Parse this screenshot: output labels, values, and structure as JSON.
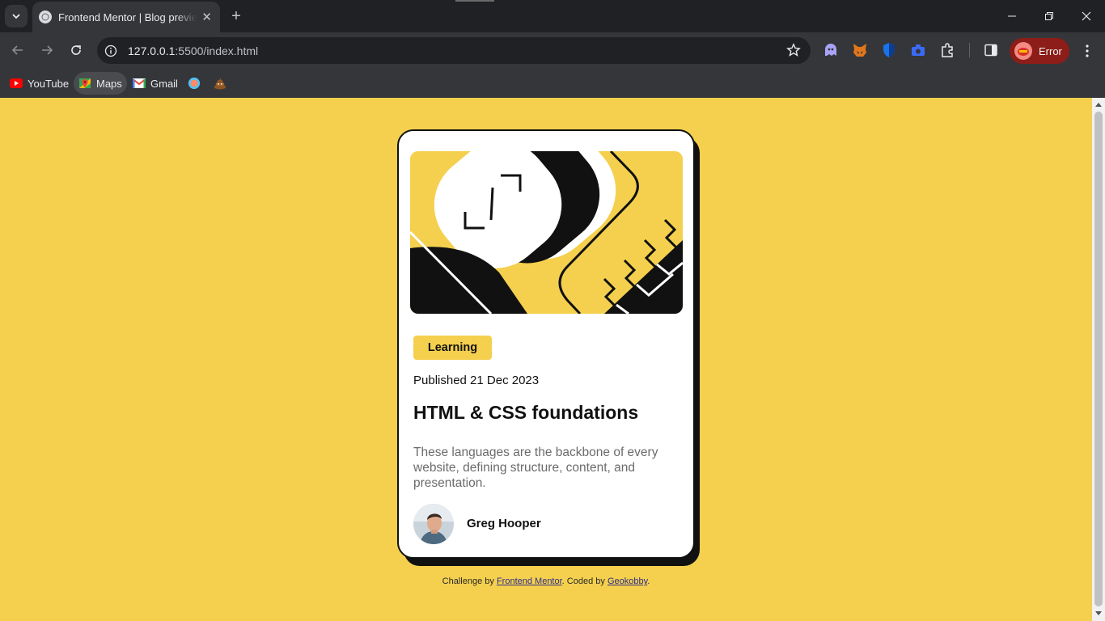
{
  "browser": {
    "tab_title": "Frontend Mentor | Blog preview card",
    "tab_close": "✕",
    "new_tab": "+",
    "url_host": "127.0.0.1",
    "url_path": ":5500/index.html",
    "profile_status": "Error",
    "bookmarks": [
      {
        "label": "YouTube",
        "icon": "youtube-icon"
      },
      {
        "label": "Maps",
        "icon": "maps-icon"
      },
      {
        "label": "Gmail",
        "icon": "gmail-icon"
      },
      {
        "label": "",
        "icon": "extension-bookmark-icon"
      },
      {
        "label": "",
        "icon": "poop-emoji-icon"
      }
    ],
    "extensions": [
      "ghost-icon",
      "metamask-fox-icon",
      "shield-icon",
      "camera-icon",
      "puzzle-icon"
    ]
  },
  "card": {
    "tag": "Learning",
    "published": "Published 21 Dec 2023",
    "title": "HTML & CSS foundations",
    "excerpt": "These languages are the backbone of every website, defining structure, content, and presentation.",
    "author": "Greg Hooper"
  },
  "attribution": {
    "prefix": "Challenge by ",
    "link1": "Frontend Mentor",
    "middle": ". Coded by ",
    "link2": "Geokobby",
    "suffix": "."
  },
  "colors": {
    "page_bg": "#f4d04e",
    "card_bg": "#ffffff",
    "ink": "#111111",
    "muted_text": "#6b6b6b",
    "error_pill": "#8c1d18"
  }
}
